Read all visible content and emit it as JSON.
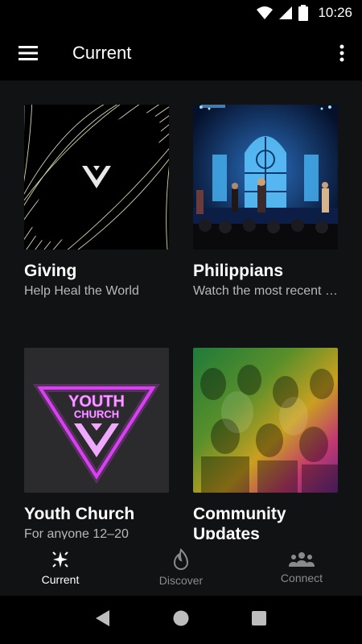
{
  "status_bar": {
    "time": "10:26"
  },
  "app_bar": {
    "title": "Current"
  },
  "cards": [
    {
      "title": "Giving",
      "subtitle": "Help Heal the World"
    },
    {
      "title": "Philippians",
      "subtitle": "Watch the most recent message"
    },
    {
      "title": "Youth Church",
      "subtitle": "For anyone 12–20",
      "logo_line1": "YOUTH",
      "logo_line2": "CHURCH"
    },
    {
      "title": "Community Updates",
      "subtitle": ""
    }
  ],
  "bottom_nav": {
    "items": [
      {
        "label": "Current",
        "icon": "sparkle-icon",
        "active": true
      },
      {
        "label": "Discover",
        "icon": "flame-icon",
        "active": false
      },
      {
        "label": "Connect",
        "icon": "group-icon",
        "active": false
      }
    ]
  },
  "colors": {
    "accent_pink": "#e040fb",
    "giving_line": "#f1eec0"
  }
}
